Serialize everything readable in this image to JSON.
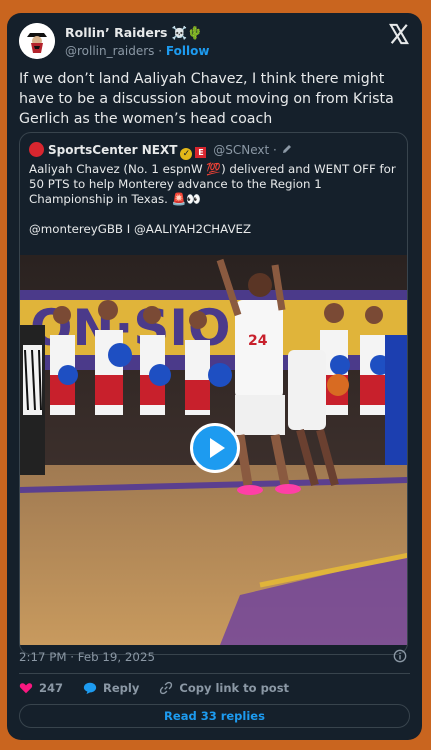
{
  "header": {
    "display_name": "Rollin’ Raiders ☠️🌵",
    "handle": "@rollin_raiders",
    "separator": "·",
    "follow_label": "Follow"
  },
  "tweet": {
    "text": "If we don’t land Aaliyah Chavez, I think there might have to be a discussion about moving on from Krista Gerlich as the women’s head coach"
  },
  "quote": {
    "display_name": "SportsCenter NEXT",
    "handle": "@SCNext",
    "separator": "·",
    "text": "Aaliyah Chavez (No. 1 espnW 💯) delivered and WENT OFF for 50 PTS to help Monterey advance to the Region 1 Championship in Texas. 🚨👀\n\n@montereyGBB I @AALIYAH2CHAVEZ"
  },
  "footer": {
    "timestamp": "2:17 PM · Feb 19, 2025",
    "like_count": "247",
    "reply_label": "Reply",
    "copy_label": "Copy link to post",
    "read_replies_label": "Read 33 replies"
  },
  "colors": {
    "background": "#c9651f",
    "card": "#15202b",
    "accent": "#1d9bf0",
    "like": "#f91880"
  },
  "icons": [
    "x-logo-icon",
    "verified-icon",
    "espn-icon",
    "pencil-icon",
    "play-icon",
    "info-icon",
    "heart-icon",
    "reply-icon",
    "link-icon"
  ]
}
